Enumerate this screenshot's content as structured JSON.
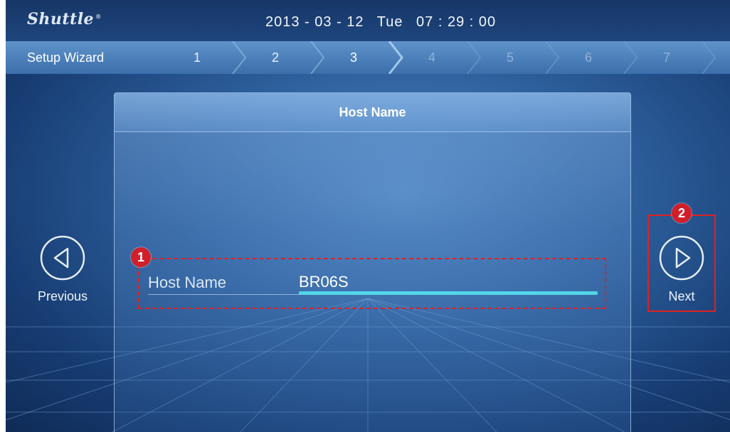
{
  "header": {
    "logo": "Shuttle",
    "logo_mark": "®",
    "date": "2013 - 03 - 12",
    "weekday": "Tue",
    "time": "07 : 29 : 00"
  },
  "wizard": {
    "label": "Setup Wizard",
    "steps": [
      "1",
      "2",
      "3",
      "4",
      "5",
      "6",
      "7"
    ],
    "current_step": 3
  },
  "panel": {
    "title": "Host Name"
  },
  "field": {
    "label": "Host Name",
    "value": "BR06S"
  },
  "nav": {
    "previous_label": "Previous",
    "next_label": "Next"
  },
  "callouts": {
    "one": "1",
    "two": "2"
  },
  "colors": {
    "accent": "#53d6e8",
    "callout_red": "#d01f2b"
  }
}
